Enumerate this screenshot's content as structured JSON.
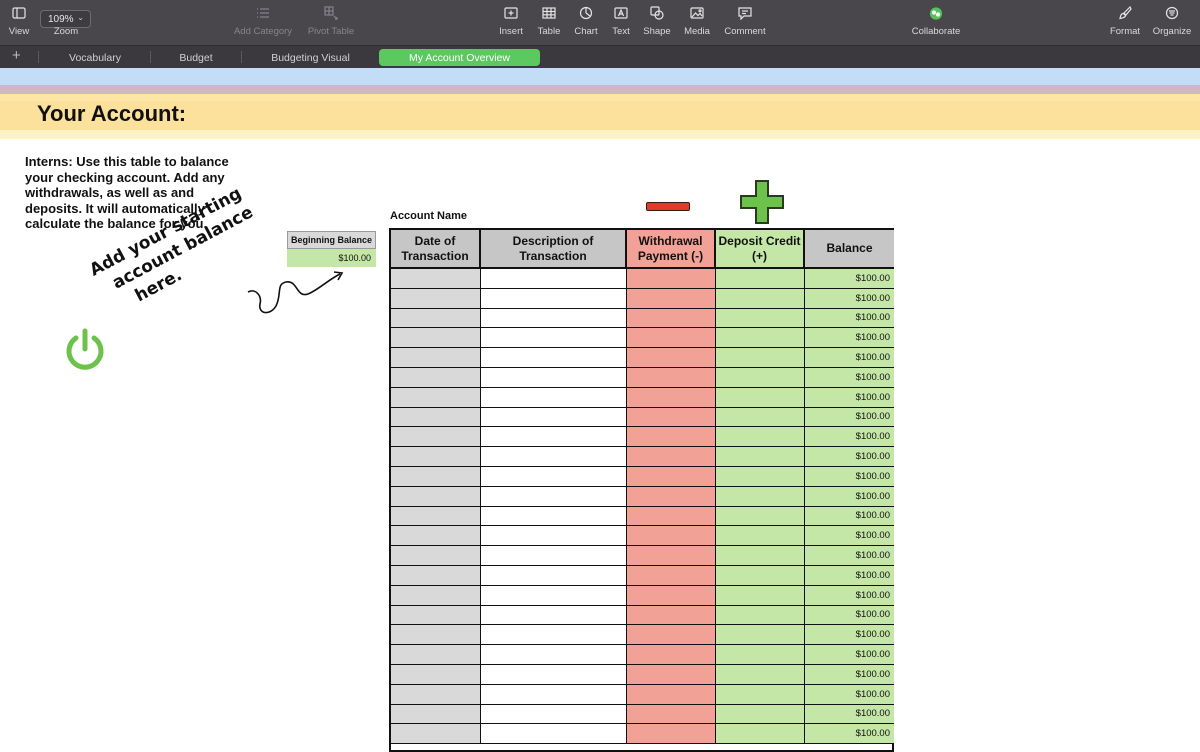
{
  "toolbar": {
    "view_label": "View",
    "zoom_value": "109%",
    "zoom_label": "Zoom",
    "add_category_label": "Add Category",
    "pivot_table_label": "Pivot Table",
    "insert_label": "Insert",
    "table_label": "Table",
    "chart_label": "Chart",
    "text_label": "Text",
    "shape_label": "Shape",
    "media_label": "Media",
    "comment_label": "Comment",
    "collaborate_label": "Collaborate",
    "format_label": "Format",
    "organize_label": "Organize"
  },
  "sheets": {
    "add_symbol": "+",
    "tabs": [
      "Vocabulary",
      "Budget",
      "Budgeting Visual",
      "My Account Overview"
    ],
    "active_tab": "My Account Overview"
  },
  "page": {
    "title": "Your Account:",
    "instructions": "Interns:  Use this table to balance your checking account.  Add any withdrawals, as well as and deposits.  It will automatically calculate the balance for you.",
    "beginning_balance_label": "Beginning Balance",
    "beginning_balance_value": "$100.00",
    "hint_lines": [
      "Add your starting",
      "account balance",
      "here."
    ],
    "account_name_label": "Account Name"
  },
  "colors": {
    "stripe_blue": "#c3ddf7",
    "stripe_mauve": "#cfb7c8",
    "stripe_light_yellow": "#fbe6a6",
    "stripe_yellow": "#fbe19b",
    "date_column": "#d9d9d9",
    "withdrawal_column": "#f2a196",
    "deposit_column": "#c4e6a6",
    "active_tab": "#5dc760"
  },
  "ledger": {
    "headers": {
      "date": "Date of Transaction",
      "description": "Description of Transaction",
      "withdrawal": "Withdrawal Payment (-)",
      "deposit": "Deposit Credit (+)",
      "balance": "Balance"
    },
    "rows": [
      {
        "date": "",
        "description": "",
        "withdrawal": "",
        "deposit": "",
        "balance": "$100.00"
      },
      {
        "date": "",
        "description": "",
        "withdrawal": "",
        "deposit": "",
        "balance": "$100.00"
      },
      {
        "date": "",
        "description": "",
        "withdrawal": "",
        "deposit": "",
        "balance": "$100.00"
      },
      {
        "date": "",
        "description": "",
        "withdrawal": "",
        "deposit": "",
        "balance": "$100.00"
      },
      {
        "date": "",
        "description": "",
        "withdrawal": "",
        "deposit": "",
        "balance": "$100.00"
      },
      {
        "date": "",
        "description": "",
        "withdrawal": "",
        "deposit": "",
        "balance": "$100.00"
      },
      {
        "date": "",
        "description": "",
        "withdrawal": "",
        "deposit": "",
        "balance": "$100.00"
      },
      {
        "date": "",
        "description": "",
        "withdrawal": "",
        "deposit": "",
        "balance": "$100.00"
      },
      {
        "date": "",
        "description": "",
        "withdrawal": "",
        "deposit": "",
        "balance": "$100.00"
      },
      {
        "date": "",
        "description": "",
        "withdrawal": "",
        "deposit": "",
        "balance": "$100.00"
      },
      {
        "date": "",
        "description": "",
        "withdrawal": "",
        "deposit": "",
        "balance": "$100.00"
      },
      {
        "date": "",
        "description": "",
        "withdrawal": "",
        "deposit": "",
        "balance": "$100.00"
      },
      {
        "date": "",
        "description": "",
        "withdrawal": "",
        "deposit": "",
        "balance": "$100.00"
      },
      {
        "date": "",
        "description": "",
        "withdrawal": "",
        "deposit": "",
        "balance": "$100.00"
      },
      {
        "date": "",
        "description": "",
        "withdrawal": "",
        "deposit": "",
        "balance": "$100.00"
      },
      {
        "date": "",
        "description": "",
        "withdrawal": "",
        "deposit": "",
        "balance": "$100.00"
      },
      {
        "date": "",
        "description": "",
        "withdrawal": "",
        "deposit": "",
        "balance": "$100.00"
      },
      {
        "date": "",
        "description": "",
        "withdrawal": "",
        "deposit": "",
        "balance": "$100.00"
      },
      {
        "date": "",
        "description": "",
        "withdrawal": "",
        "deposit": "",
        "balance": "$100.00"
      },
      {
        "date": "",
        "description": "",
        "withdrawal": "",
        "deposit": "",
        "balance": "$100.00"
      },
      {
        "date": "",
        "description": "",
        "withdrawal": "",
        "deposit": "",
        "balance": "$100.00"
      },
      {
        "date": "",
        "description": "",
        "withdrawal": "",
        "deposit": "",
        "balance": "$100.00"
      },
      {
        "date": "",
        "description": "",
        "withdrawal": "",
        "deposit": "",
        "balance": "$100.00"
      },
      {
        "date": "",
        "description": "",
        "withdrawal": "",
        "deposit": "",
        "balance": "$100.00"
      }
    ]
  }
}
